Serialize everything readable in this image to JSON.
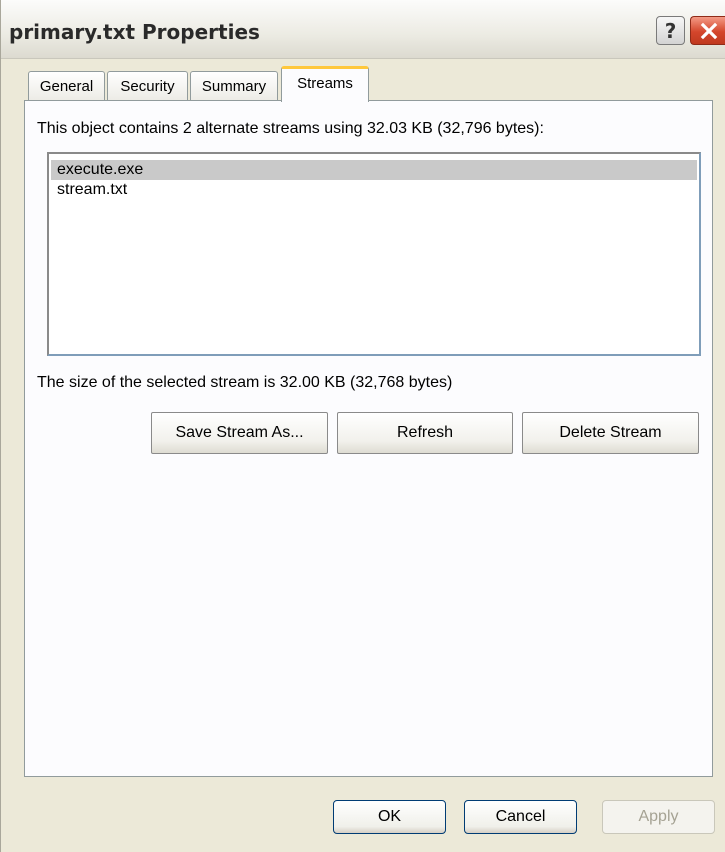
{
  "window": {
    "title": "primary.txt Properties",
    "help_label": "?"
  },
  "tabs": [
    {
      "label": "General"
    },
    {
      "label": "Security"
    },
    {
      "label": "Summary"
    },
    {
      "label": "Streams",
      "active": true
    }
  ],
  "streams": {
    "summary": "This object contains 2 alternate streams using 32.03 KB (32,796 bytes):",
    "items": [
      {
        "name": "execute.exe",
        "selected": true
      },
      {
        "name": "stream.txt",
        "selected": false
      }
    ],
    "selected_size": "The size of the selected stream is 32.00 KB (32,768 bytes)",
    "buttons": {
      "save": "Save Stream As...",
      "refresh": "Refresh",
      "delete": "Delete Stream"
    }
  },
  "footer": {
    "ok": "OK",
    "cancel": "Cancel",
    "apply": "Apply",
    "apply_enabled": false
  },
  "colors": {
    "dialog_bg": "#ece9d8",
    "tab_highlight": "#ffc83c",
    "close_button": "#d4462c",
    "selection": "#c9c9c9"
  }
}
